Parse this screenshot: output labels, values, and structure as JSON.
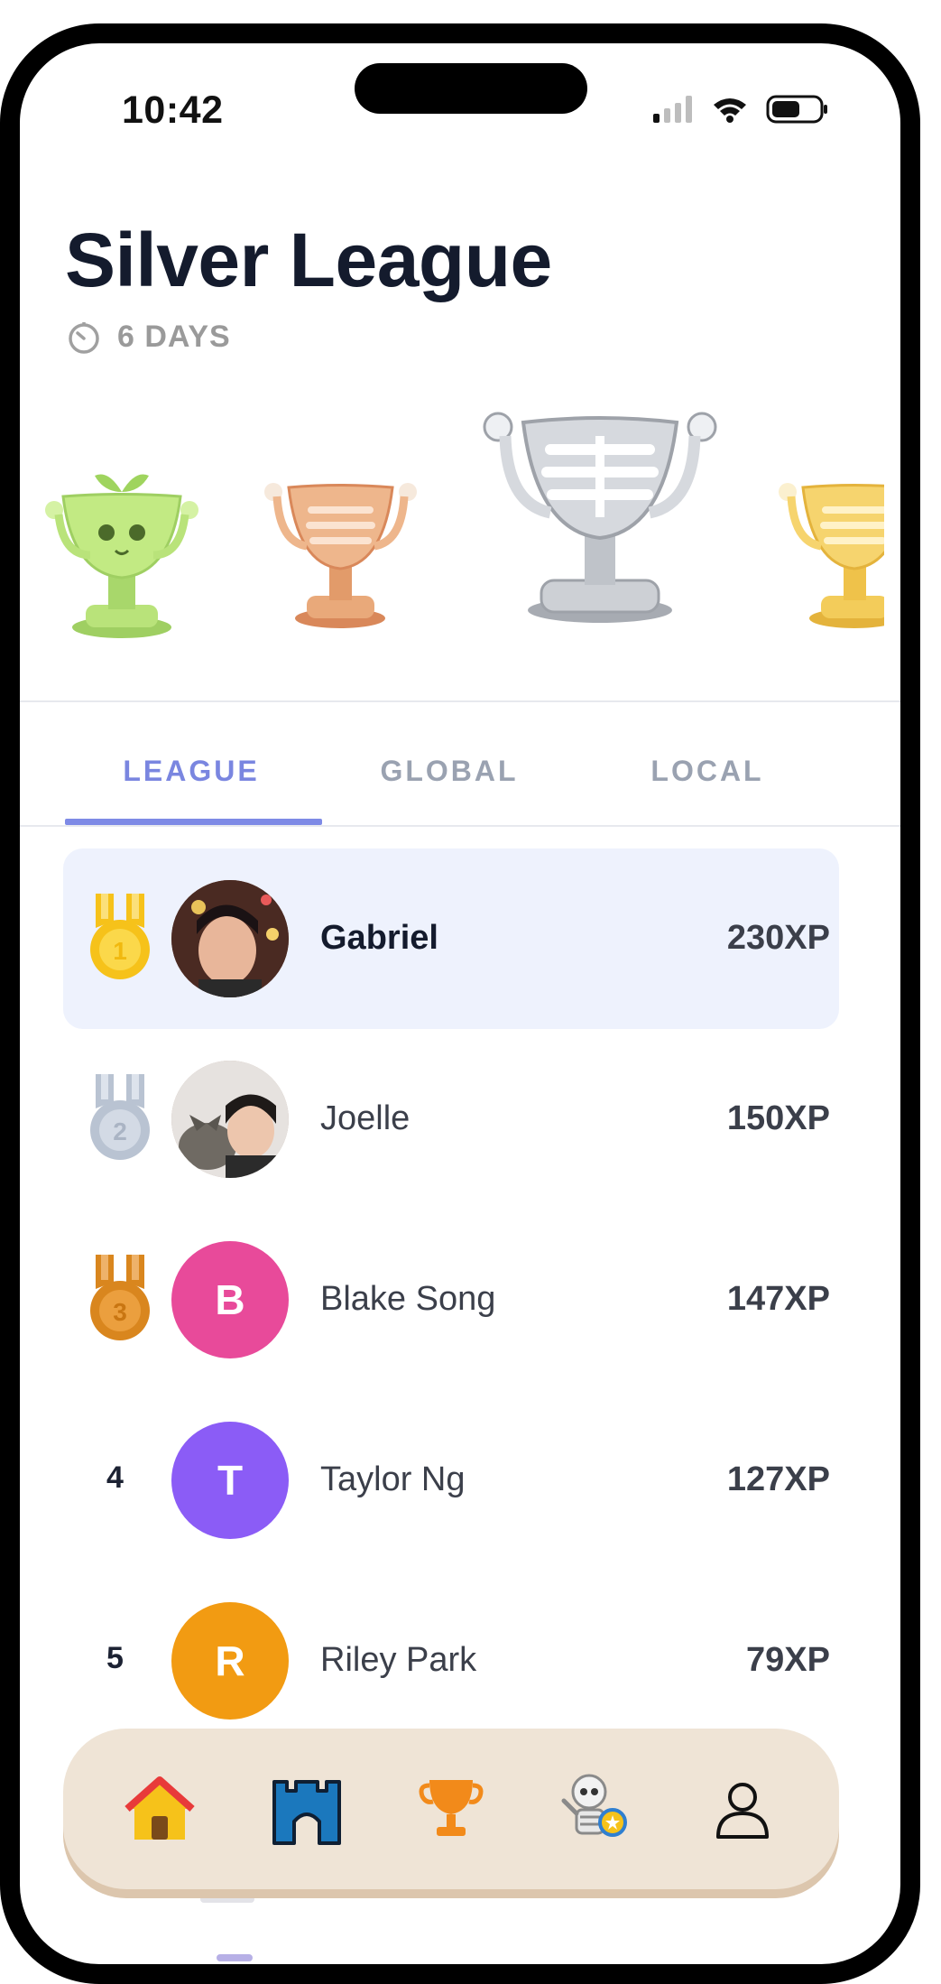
{
  "status_bar": {
    "time": "10:42"
  },
  "header": {
    "title": "Silver League",
    "countdown": "6 DAYS"
  },
  "trophies": [
    {
      "name": "sprout-trophy",
      "color": "#b9e37a"
    },
    {
      "name": "bronze-trophy",
      "color": "#e9a97a"
    },
    {
      "name": "silver-trophy",
      "color": "#c8cbd0"
    },
    {
      "name": "gold-trophy",
      "color": "#f3cc5a"
    }
  ],
  "tabs": [
    {
      "label": "LEAGUE",
      "active": true
    },
    {
      "label": "GLOBAL",
      "active": false
    },
    {
      "label": "LOCAL",
      "active": false
    }
  ],
  "leaderboard": [
    {
      "rank": "1",
      "name": "Gabriel",
      "xp": "230XP",
      "medal": "gold",
      "initial": "",
      "avatar_color": "#7a4a3a",
      "highlight": true
    },
    {
      "rank": "2",
      "name": "Joelle",
      "xp": "150XP",
      "medal": "silver",
      "initial": "",
      "avatar_color": "#bfa99a",
      "highlight": false
    },
    {
      "rank": "3",
      "name": "Blake Song",
      "xp": "147XP",
      "medal": "bronze",
      "initial": "B",
      "avatar_color": "#e84a9a",
      "highlight": false
    },
    {
      "rank": "4",
      "name": "Taylor Ng",
      "xp": "127XP",
      "medal": "",
      "initial": "T",
      "avatar_color": "#8b5cf6",
      "highlight": false
    },
    {
      "rank": "5",
      "name": "Riley Park",
      "xp": "79XP",
      "medal": "",
      "initial": "R",
      "avatar_color": "#f29b12",
      "highlight": false
    }
  ],
  "nav": [
    {
      "icon": "home-icon"
    },
    {
      "icon": "castle-icon"
    },
    {
      "icon": "trophy-icon"
    },
    {
      "icon": "skeleton-badge-icon"
    },
    {
      "icon": "profile-icon"
    }
  ],
  "colors": {
    "accent": "#7e8ae6",
    "highlight_row": "#eef2fd",
    "navbar": "#efe4d6",
    "gold_medal": "#f6c21a",
    "silver_medal": "#b9c3d2",
    "bronze_medal": "#d9861e"
  }
}
